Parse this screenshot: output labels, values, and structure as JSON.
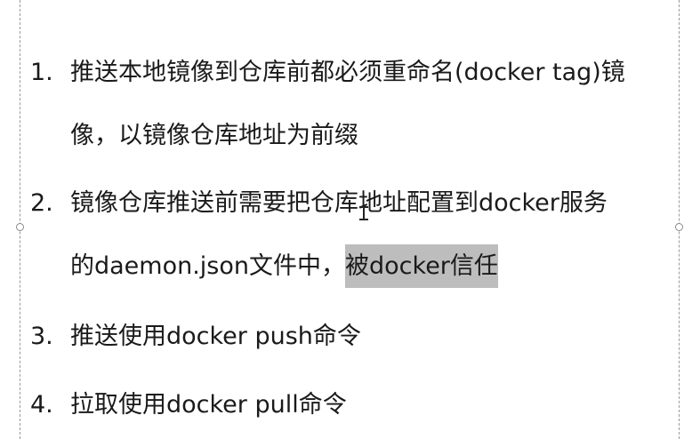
{
  "list": {
    "item1": {
      "number": "1.",
      "line1": "推送本地镜像到仓库前都必须重命名(docker tag)镜",
      "line2": "像，以镜像仓库地址为前缀"
    },
    "item2": {
      "number": "2.",
      "line1": "镜像仓库推送前需要把仓库地址配置到docker服务",
      "line2_plain": "的daemon.json文件中，",
      "line2_highlight": "被docker信任"
    },
    "item3": {
      "number": "3.",
      "line1": "推送使用docker push命令"
    },
    "item4": {
      "number": "4.",
      "line1": "拉取使用docker pull命令"
    }
  },
  "colors": {
    "highlight": "#bdbdbd",
    "text": "#1a1a1a"
  },
  "icons": [
    "text-cursor-icon",
    "resize-handle-icon"
  ]
}
